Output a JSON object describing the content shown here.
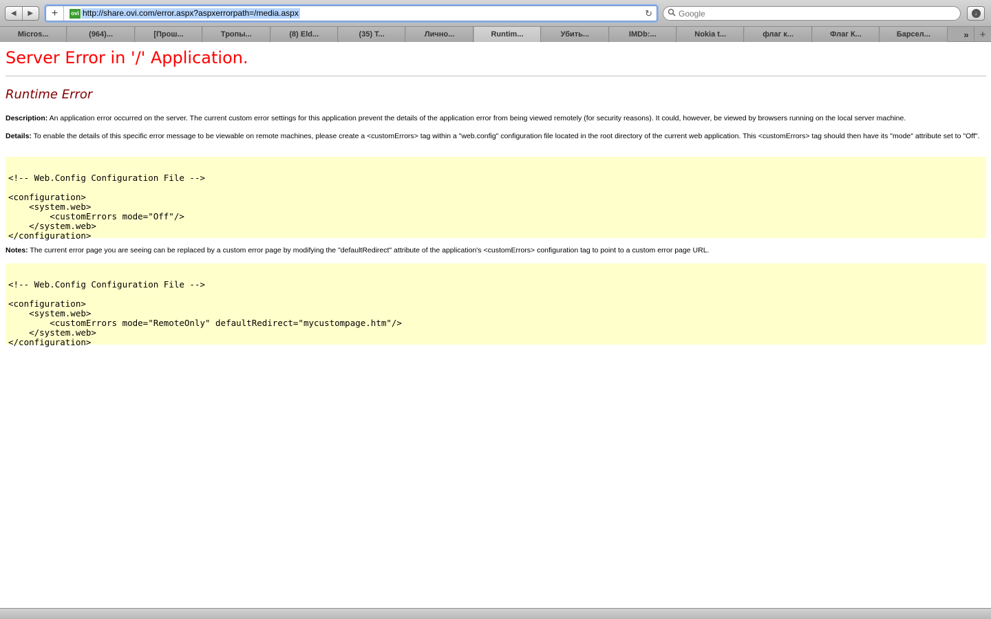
{
  "browser": {
    "back_icon": "◀",
    "forward_icon": "▶",
    "add_icon": "+",
    "favicon_label": "ovi",
    "url": "http://share.ovi.com/error.aspx?aspxerrorpath=/media.aspx",
    "reload_icon": "↻",
    "search_placeholder": "Google",
    "tabs": [
      {
        "label": "Micros..."
      },
      {
        "label": "(964)..."
      },
      {
        "label": "[Прош..."
      },
      {
        "label": "Тропы..."
      },
      {
        "label": "(8) Eld..."
      },
      {
        "label": "(35) T..."
      },
      {
        "label": "Лично..."
      },
      {
        "label": "Runtim..."
      },
      {
        "label": "Убить..."
      },
      {
        "label": "IMDb:..."
      },
      {
        "label": "Nokia t..."
      },
      {
        "label": "флаг к..."
      },
      {
        "label": "Флаг К..."
      },
      {
        "label": "Барсел..."
      }
    ],
    "active_tab_index": 7,
    "tab_overflow_icon": "»",
    "new_tab_icon": "+"
  },
  "page": {
    "title": "Server Error in '/' Application.",
    "subtitle": "Runtime Error",
    "description_label": "Description:",
    "description_text": " An application error occurred on the server. The current custom error settings for this application prevent the details of the application error from being viewed remotely (for security reasons). It could, however, be viewed by browsers running on the local server machine.",
    "details_label": "Details:",
    "details_text": " To enable the details of this specific error message to be viewable on remote machines, please create a <customErrors> tag within a \"web.config\" configuration file located in the root directory of the current web application. This <customErrors> tag should then have its \"mode\" attribute set to \"Off\".",
    "code1": "\n<!-- Web.Config Configuration File -->\n\n<configuration>\n    <system.web>\n        <customErrors mode=\"Off\"/>\n    </system.web>\n</configuration>",
    "notes_label": "Notes:",
    "notes_text": " The current error page you are seeing can be replaced by a custom error page by modifying the \"defaultRedirect\" attribute of the application's <customErrors> configuration tag to point to a custom error page URL.",
    "code2": "\n<!-- Web.Config Configuration File -->\n\n<configuration>\n    <system.web>\n        <customErrors mode=\"RemoteOnly\" defaultRedirect=\"mycustompage.htm\"/>\n    </system.web>\n</configuration>"
  }
}
